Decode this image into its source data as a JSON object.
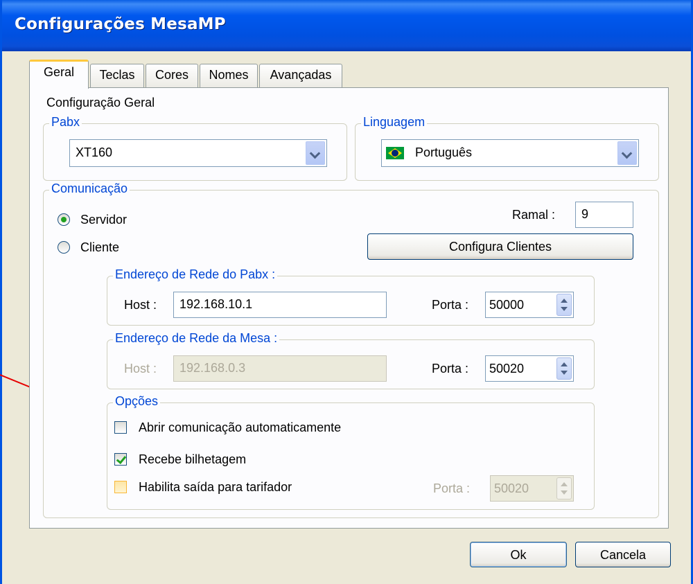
{
  "window": {
    "title": "Configurações MesaMP"
  },
  "tabs": [
    "Geral",
    "Teclas",
    "Cores",
    "Nomes",
    "Avançadas"
  ],
  "general": {
    "heading": "Configuração Geral",
    "pabx": {
      "legend": "Pabx",
      "value": "XT160"
    },
    "language": {
      "legend": "Linguagem",
      "value": "Português",
      "flag": "brazil-flag-icon"
    }
  },
  "communication": {
    "legend": "Comunicação",
    "server_label": "Servidor",
    "client_label": "Cliente",
    "selected": "Servidor",
    "ramal_label": "Ramal :",
    "ramal_value": "9",
    "configure_clients_label": "Configura Clientes",
    "pabx_address": {
      "legend": "Endereço de Rede do Pabx :",
      "host_label": "Host :",
      "host_value": "192.168.10.1",
      "port_label": "Porta :",
      "port_value": "50000"
    },
    "mesa_address": {
      "legend": "Endereço de Rede da Mesa :",
      "host_label": "Host :",
      "host_value": "192.168.0.3",
      "port_label": "Porta :",
      "port_value": "50020"
    },
    "options": {
      "legend": "Opções",
      "auto_open_label": "Abrir comunicação automaticamente",
      "auto_open_checked": false,
      "receive_billing_label": "Recebe bilhetagem",
      "receive_billing_checked": true,
      "tariff_output_label": "Habilita saída para tarifador",
      "tariff_output_checked": false,
      "tariff_port_label": "Porta :",
      "tariff_port_value": "50020"
    }
  },
  "footer": {
    "ok_label": "Ok",
    "cancel_label": "Cancela"
  },
  "colors": {
    "title_bar": "#0054e3",
    "group_legend": "#0046d5",
    "annotation_arrow": "#e60000",
    "dialog_bg": "#ece9d8"
  }
}
